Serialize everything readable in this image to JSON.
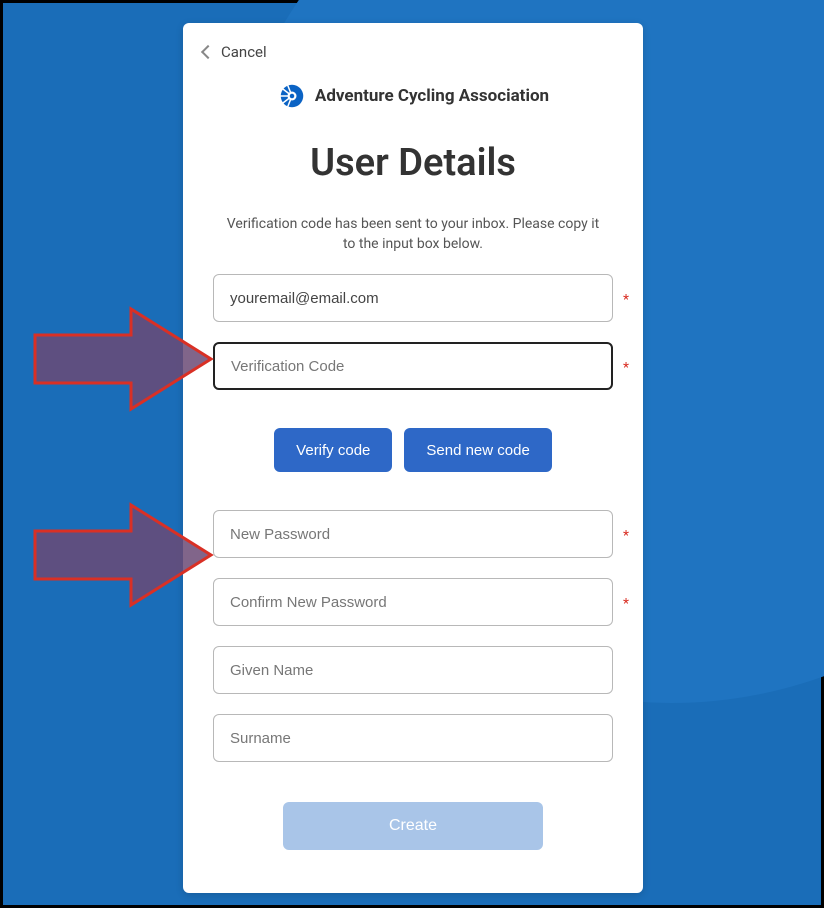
{
  "cancel_label": "Cancel",
  "brand_name": "Adventure Cycling Association",
  "page_title": "User Details",
  "info_message": "Verification code has been sent to your inbox. Please copy it to the input box below.",
  "fields": {
    "email": {
      "value": "youremail@email.com",
      "required": true
    },
    "verification_code": {
      "placeholder": "Verification Code",
      "required": true
    },
    "new_password": {
      "placeholder": "New Password",
      "required": true
    },
    "confirm_password": {
      "placeholder": "Confirm New Password",
      "required": true
    },
    "given_name": {
      "placeholder": "Given Name",
      "required": false
    },
    "surname": {
      "placeholder": "Surname",
      "required": false
    }
  },
  "buttons": {
    "verify": "Verify code",
    "resend": "Send new code",
    "create": "Create"
  },
  "colors": {
    "background": "#1a6db8",
    "primary_button": "#2e68c7",
    "disabled_button": "#a9c5e8",
    "arrow_fill": "#6b4a76",
    "arrow_stroke": "#d93025"
  },
  "asterisk": "*"
}
